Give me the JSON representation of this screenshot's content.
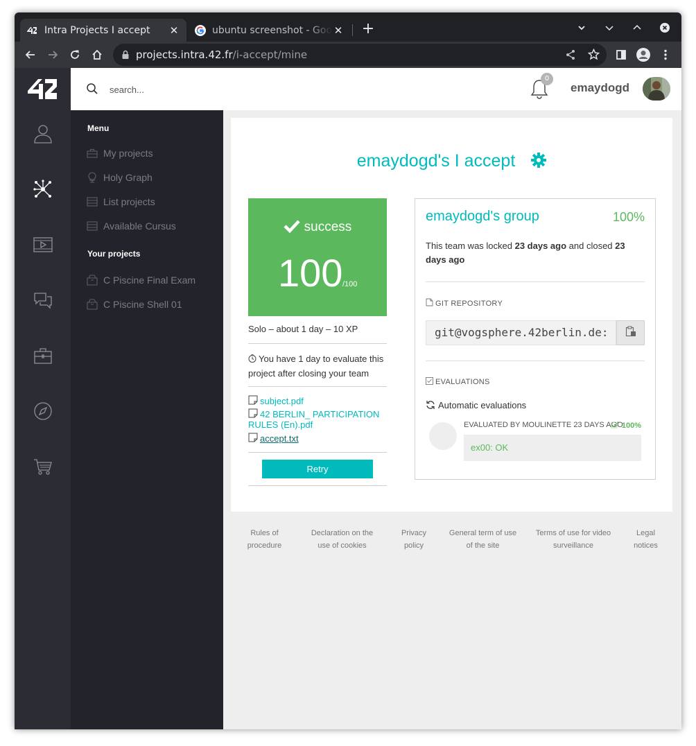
{
  "browser": {
    "tabs": [
      {
        "title": "Intra Projects I accept",
        "active": true
      },
      {
        "title": "ubuntu screenshot - Google",
        "active": false
      }
    ],
    "url_host": "projects.intra.42.fr",
    "url_path": "/i-accept/mine"
  },
  "topbar": {
    "search_placeholder": "search...",
    "notifications_count": "0",
    "username": "emaydogd"
  },
  "menu": {
    "heading": "Menu",
    "items": [
      {
        "label": "My projects",
        "icon": "briefcase-icon"
      },
      {
        "label": "Holy Graph",
        "icon": "globe-icon"
      },
      {
        "label": "List projects",
        "icon": "list-icon"
      },
      {
        "label": "Available Cursus",
        "icon": "list-icon"
      }
    ],
    "projects_heading": "Your projects",
    "projects": [
      {
        "label": "C Piscine Final Exam",
        "icon": "box-icon"
      },
      {
        "label": "C Piscine Shell 01",
        "icon": "box-icon"
      }
    ]
  },
  "project": {
    "title": "emaydogd's I accept",
    "status": "success",
    "score": "100",
    "score_max": "/100",
    "meta": "Solo – about 1 day – 10 XP",
    "evaluation_notice": "You have 1 day to evaluate this project after closing your team",
    "files": [
      {
        "name": "subject.pdf"
      },
      {
        "name": "42 BERLIN_ PARTICIPATION RULES (En).pdf"
      },
      {
        "name": "accept.txt"
      }
    ],
    "retry_label": "Retry"
  },
  "group": {
    "name": "emaydogd's group",
    "percent": "100%",
    "locked_prefix": "This team was locked ",
    "locked_time": "23 days ago",
    "closed_prefix": " and closed ",
    "closed_time": "23 days ago",
    "git_label": "GIT REPOSITORY",
    "git_url": "git@vogsphere.42berlin.de:",
    "evaluations_label": "EVALUATIONS",
    "auto_eval_label": "Automatic evaluations",
    "evaluated_by": "EVALUATED BY MOULINETTE 23 DAYS AGO",
    "eval_percent": "100%",
    "eval_result": "ex00: OK"
  },
  "footer": {
    "links": [
      {
        "line1": "Rules of",
        "line2": "procedure"
      },
      {
        "line1": "Declaration on the",
        "line2": "use of cookies"
      },
      {
        "line1": "Privacy",
        "line2": "policy"
      },
      {
        "line1": "General term of use",
        "line2": "of the site"
      },
      {
        "line1": "Terms of use for video",
        "line2": "surveillance"
      },
      {
        "line1": "Legal",
        "line2": "notices"
      }
    ]
  },
  "colors": {
    "accent": "#00babc",
    "success": "#5cb85c",
    "sidebar": "#2c2c34",
    "menu_panel": "#23232b"
  }
}
